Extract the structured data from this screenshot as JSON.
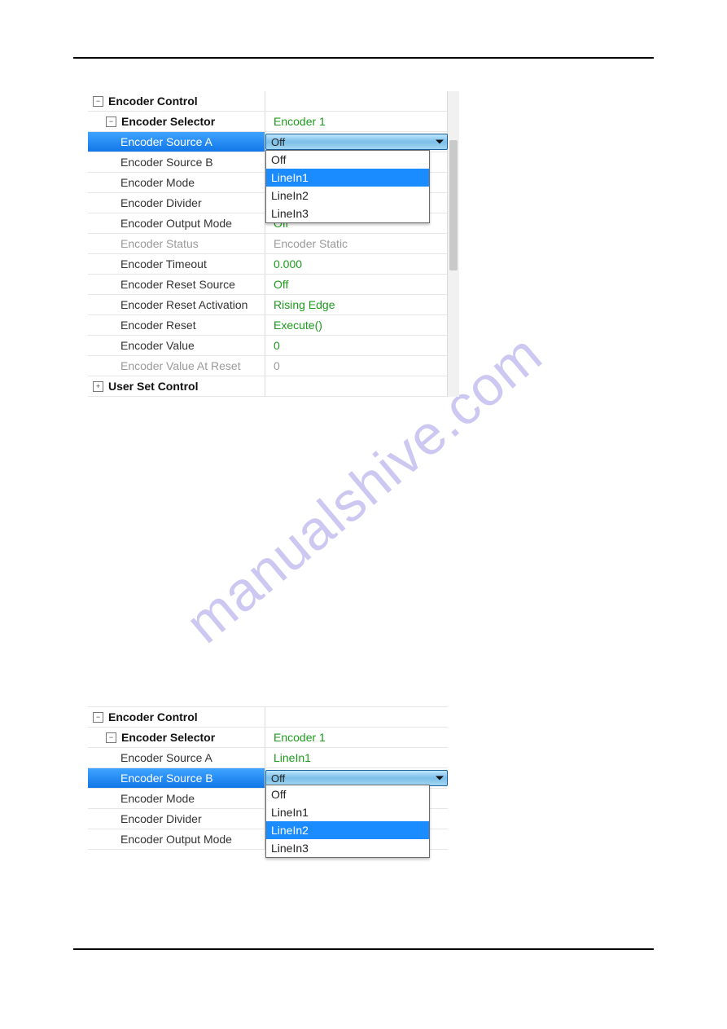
{
  "watermark": "manualshive.com",
  "panel1": {
    "encoder_control": "Encoder Control",
    "encoder_selector_label": "Encoder Selector",
    "encoder_selector_value": "Encoder 1",
    "source_a_label": "Encoder Source A",
    "combo_a_value": "Off",
    "dropdown_a": [
      "Off",
      "LineIn1",
      "LineIn2",
      "LineIn3"
    ],
    "dropdown_a_highlight_index": 1,
    "source_b_label": "Encoder Source B",
    "mode_label": "Encoder Mode",
    "divider_label": "Encoder Divider",
    "output_mode_label": "Encoder Output Mode",
    "output_mode_value": "Off",
    "status_label": "Encoder Status",
    "status_value": "Encoder Static",
    "timeout_label": "Encoder Timeout",
    "timeout_value": "0.000",
    "reset_source_label": "Encoder Reset Source",
    "reset_source_value": "Off",
    "reset_activation_label": "Encoder Reset Activation",
    "reset_activation_value": "Rising Edge",
    "reset_label": "Encoder Reset",
    "reset_value": "Execute()",
    "value_label": "Encoder Value",
    "value_value": "0",
    "value_at_reset_label": "Encoder Value At Reset",
    "value_at_reset_value": "0",
    "user_set_control": "User Set Control"
  },
  "panel2": {
    "encoder_control": "Encoder Control",
    "encoder_selector_label": "Encoder Selector",
    "encoder_selector_value": "Encoder 1",
    "source_a_label": "Encoder Source A",
    "source_a_value": "LineIn1",
    "source_b_label": "Encoder Source B",
    "combo_b_value": "Off",
    "dropdown_b": [
      "Off",
      "LineIn1",
      "LineIn2",
      "LineIn3"
    ],
    "dropdown_b_highlight_index": 2,
    "mode_label": "Encoder Mode",
    "divider_label": "Encoder Divider",
    "output_mode_label": "Encoder Output Mode"
  }
}
